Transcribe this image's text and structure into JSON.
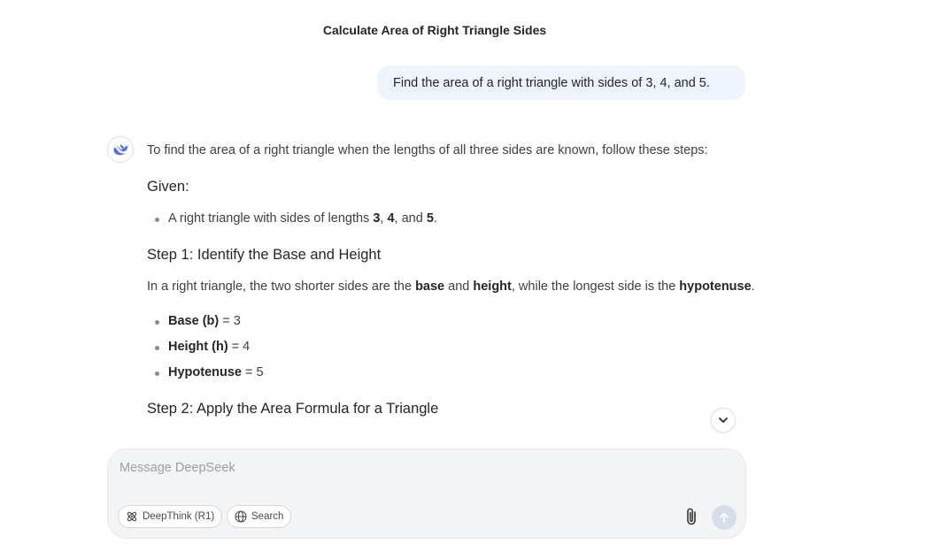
{
  "chat": {
    "title": "Calculate Area of Right Triangle Sides"
  },
  "user_message": "Find the area of a right triangle with sides of 3, 4, and 5.",
  "answer": {
    "intro": "To find the area of a right triangle when the lengths of all three sides are known, follow these steps:",
    "given_heading": "Given:",
    "given_item": {
      "prefix": "A right triangle with sides of lengths ",
      "a": "3",
      "sep1": ", ",
      "b": "4",
      "sep2": ", and ",
      "c": "5",
      "suffix": "."
    },
    "step1": {
      "heading": "Step 1: Identify the Base and Height",
      "para": {
        "t1": "In a right triangle, the two shorter sides are the ",
        "base": "base",
        "t2": " and ",
        "height": "height",
        "t3": ", while the longest side is the ",
        "hyp": "hypotenuse",
        "t4": "."
      },
      "items": [
        {
          "label": "Base (b)",
          "value": " = 3"
        },
        {
          "label": "Height (h)",
          "value": " = 4"
        },
        {
          "label": "Hypotenuse",
          "value": " = 5"
        }
      ]
    },
    "step2": {
      "heading": "Step 2: Apply the Area Formula for a Triangle"
    }
  },
  "composer": {
    "placeholder": "Message DeepSeek",
    "deepthink_label": "DeepThink (R1)",
    "search_label": "Search"
  },
  "icons": {
    "avatar": "deepseek-whale-icon",
    "scroll": "chevron-down-icon",
    "deepthink": "atom-icon",
    "search": "globe-icon",
    "attach": "paperclip-icon",
    "send": "arrow-up-icon"
  },
  "colors": {
    "accent": "#4d6bfe",
    "user_bubble": "#eef3fd",
    "composer_bg": "#f3f4f6",
    "send_disabled": "#d6dee9"
  }
}
